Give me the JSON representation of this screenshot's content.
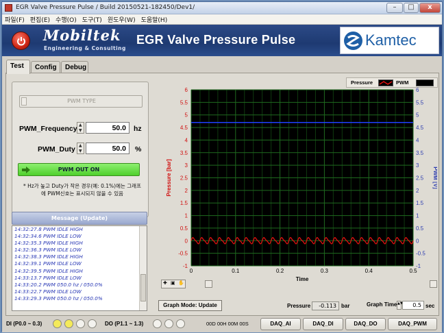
{
  "window": {
    "title": "EGR Valve Pressure Pulse / Build 20150521-182450/Dev1/"
  },
  "window_buttons": {
    "minimize": "–",
    "maximize": "□",
    "close": "x"
  },
  "menu": [
    "파일(F)",
    "편집(E)",
    "수행(O)",
    "도구(T)",
    "윈도우(W)",
    "도움말(H)"
  ],
  "banner": {
    "logo": "Mobiltek",
    "logo_sub": "Engineering & Consulting",
    "app_title": "EGR Valve Pressure Pulse",
    "brand": "Kamtec"
  },
  "tabs": [
    {
      "label": "Test"
    },
    {
      "label": "Config"
    },
    {
      "label": "Debug"
    }
  ],
  "controls": {
    "pwm_type": {
      "label": "PWM TYPE"
    },
    "pwm_frequency": {
      "label": "PWM_Frequency",
      "value": "50.0",
      "unit": "hz"
    },
    "pwm_duty": {
      "label": "PWM_Duty",
      "value": "50.0",
      "unit": "%"
    },
    "pwm_out_button": "PWM OUT ON",
    "note": "* Hz가 높고 Duty가 작은 경우(예: 0.1%)에는 그래프에 PWM신호는 표시되지 않을 수 있음"
  },
  "messages": {
    "header": "Message (Update)",
    "lines": [
      "14:32:27.8 PWM IDLE HIGH",
      "14:32:34.6 PWM IDLE LOW",
      "14:32:35.3 PWM IDLE HIGH",
      "14:32:36.3 PWM IDLE LOW",
      "14:32:38.3 PWM IDLE HIGH",
      "14:32:39.1 PWM IDLE LOW",
      "14:32:39.5 PWM IDLE HIGH",
      "14:33:13.7 PWM IDLE LOW",
      "14:33:20.2 PWM 050.0 hz / 050.0%",
      "14:33:22.7 PWM IDLE LOW",
      "14:33:29.3 PWM 050.0 hz / 050.0%"
    ]
  },
  "graph": {
    "legend_pressure": "Pressure",
    "legend_pwm": "PWM",
    "mode_button": "Graph Mode: Update",
    "pressure_label": "Pressure",
    "pressure_value": "-0.113",
    "pressure_unit": "bar",
    "graph_time_label": "Graph Time",
    "graph_time_value": "0.5",
    "graph_time_unit": "sec"
  },
  "chart_data": {
    "type": "line",
    "xlabel": "Time",
    "ylabel": "Pressure [bar]",
    "y2label": "PWM [V]",
    "xlim": [
      0,
      0.5
    ],
    "ylim": [
      -1,
      6
    ],
    "y2lim": [
      -1,
      6
    ],
    "xticks": [
      "0",
      "0.1",
      "0.2",
      "0.3",
      "0.4",
      "0.5"
    ],
    "yticks": [
      "-1",
      "-0.5",
      "0",
      "0.5",
      "1",
      "1.5",
      "2",
      "2.5",
      "3",
      "3.5",
      "4",
      "4.5",
      "5",
      "5.5",
      "6"
    ],
    "y2ticks": [
      "-1",
      "-0.5",
      "0",
      "0.5",
      "1",
      "1.5",
      "2",
      "2.5",
      "3",
      "3.5",
      "4",
      "4.5",
      "5",
      "5.5",
      "6"
    ],
    "grid": true,
    "series": [
      {
        "name": "Pressure",
        "color": "#e01010",
        "pattern": "oscillation",
        "mean": 0,
        "amplitude": 0.11,
        "frequency_hz": 50
      },
      {
        "name": "PWM",
        "color": "#2040ff",
        "pattern": "flat",
        "value": 4.7
      }
    ]
  },
  "status": {
    "di_label": "DI (P0.0 ~ 0.3)",
    "di_leds": [
      "on",
      "on",
      "off",
      "off"
    ],
    "do_label": "DO (P1.1 ~ 1.3)",
    "do_leds": [
      "off",
      "off",
      "off"
    ],
    "hex": "00D 00H 00M 00S",
    "buttons": [
      "DAQ_AI",
      "DAQ_DI",
      "DAQ_DO",
      "DAQ_PWM"
    ]
  },
  "colors": {
    "banner": "#1e3a72",
    "pwm_button": "#4fcf2c",
    "message_text": "#2a39b5",
    "pressure": "#e01010",
    "pwm": "#2040ff",
    "led_on": "#f4ea5a"
  }
}
